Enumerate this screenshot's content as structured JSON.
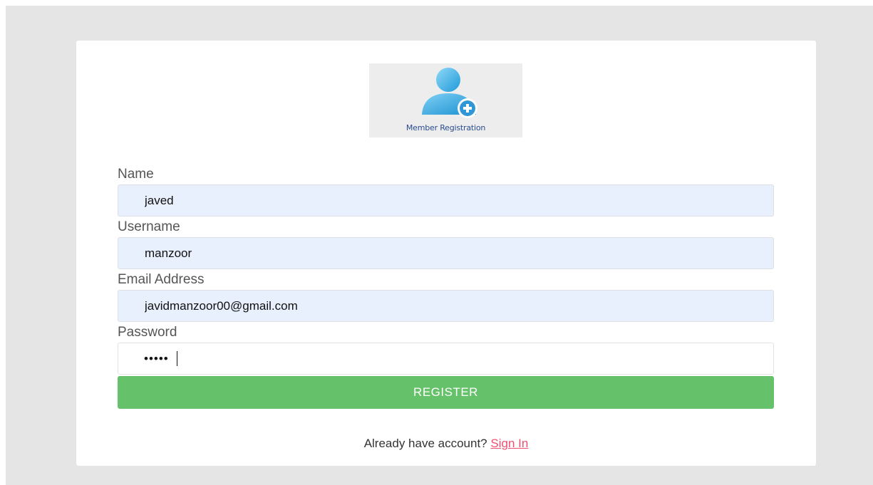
{
  "logo": {
    "caption": "Member Registration",
    "icon": "user-add-icon"
  },
  "form": {
    "name_label": "Name",
    "name_value": "javed",
    "username_label": "Username",
    "username_value": "manzoor",
    "email_label": "Email Address",
    "email_value": "javidmanzoor00@gmail.com",
    "password_label": "Password",
    "password_value": "•••••",
    "register_label": "REGISTER"
  },
  "footer": {
    "prompt": "Already have account?",
    "signin_label": "Sign In"
  },
  "colors": {
    "background": "#e5e5e5",
    "autofill": "#e8f0fe",
    "button": "#65c26a",
    "link": "#f0506e"
  }
}
